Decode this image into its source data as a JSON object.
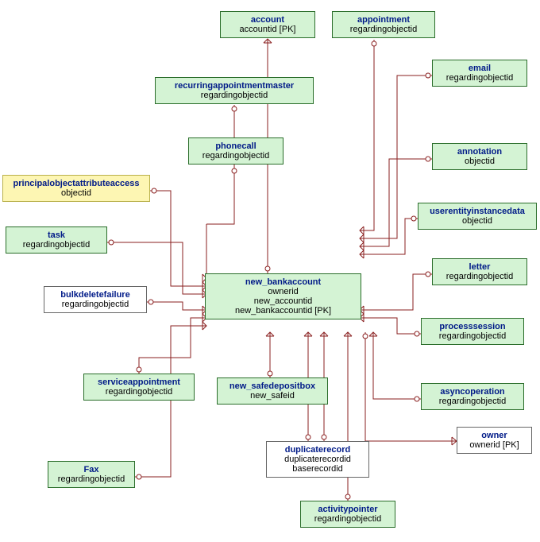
{
  "entities": {
    "account": {
      "title": "account",
      "attrs": [
        "accountid [PK]"
      ]
    },
    "appointment": {
      "title": "appointment",
      "attrs": [
        "regardingobjectid"
      ]
    },
    "email": {
      "title": "email",
      "attrs": [
        "regardingobjectid"
      ]
    },
    "recurringappointmentmaster": {
      "title": "recurringappointmentmaster",
      "attrs": [
        "regardingobjectid"
      ]
    },
    "phonecall": {
      "title": "phonecall",
      "attrs": [
        "regardingobjectid"
      ]
    },
    "annotation": {
      "title": "annotation",
      "attrs": [
        "objectid"
      ]
    },
    "principalobjectattributeaccess": {
      "title": "principalobjectattributeaccess",
      "attrs": [
        "objectid"
      ]
    },
    "task": {
      "title": "task",
      "attrs": [
        "regardingobjectid"
      ]
    },
    "userentityinstancedata": {
      "title": "userentityinstancedata",
      "attrs": [
        "objectid"
      ]
    },
    "letter": {
      "title": "letter",
      "attrs": [
        "regardingobjectid"
      ]
    },
    "new_bankaccount": {
      "title": "new_bankaccount",
      "attrs": [
        "ownerid",
        "new_accountid",
        "new_bankaccountid [PK]"
      ]
    },
    "bulkdeletefailure": {
      "title": "bulkdeletefailure",
      "attrs": [
        "regardingobjectid"
      ]
    },
    "processsession": {
      "title": "processsession",
      "attrs": [
        "regardingobjectid"
      ]
    },
    "serviceappointment": {
      "title": "serviceappointment",
      "attrs": [
        "regardingobjectid"
      ]
    },
    "new_safedepositbox": {
      "title": "new_safedepositbox",
      "attrs": [
        "new_safeid"
      ]
    },
    "asyncoperation": {
      "title": "asyncoperation",
      "attrs": [
        "regardingobjectid"
      ]
    },
    "owner": {
      "title": "owner",
      "attrs": [
        "ownerid [PK]"
      ]
    },
    "duplicaterecord": {
      "title": "duplicaterecord",
      "attrs": [
        "duplicaterecordid",
        "baserecordid"
      ]
    },
    "fax": {
      "title": "Fax",
      "attrs": [
        "regardingobjectid"
      ]
    },
    "activitypointer": {
      "title": "activitypointer",
      "attrs": [
        "regardingobjectid"
      ]
    }
  }
}
